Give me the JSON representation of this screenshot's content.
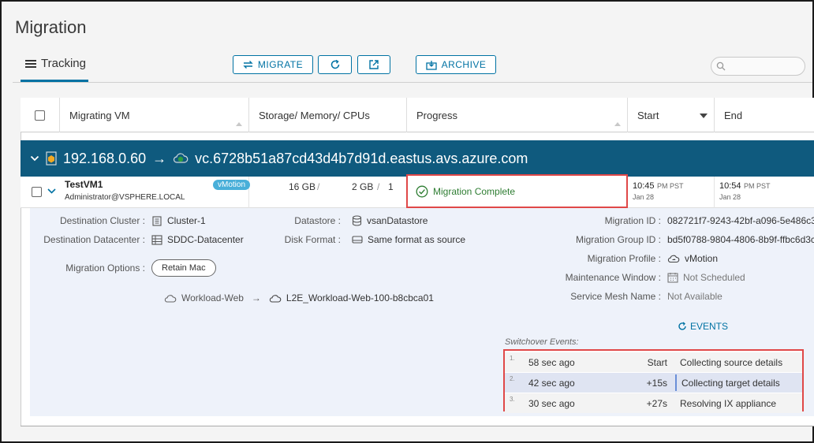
{
  "page": {
    "title": "Migration"
  },
  "tabs": [
    {
      "label": "Tracking",
      "active": true
    }
  ],
  "toolbar": {
    "migrate_label": "MIGRATE",
    "archive_label": "ARCHIVE",
    "refresh_icon": "refresh-icon",
    "export_icon": "export-icon"
  },
  "search": {
    "placeholder": ""
  },
  "columns": [
    {
      "label": "Migrating VM"
    },
    {
      "label": "Storage/ Memory/ CPUs"
    },
    {
      "label": "Progress"
    },
    {
      "label": "Start"
    },
    {
      "label": "End"
    }
  ],
  "group": {
    "source": "192.168.0.60",
    "arrow": "→",
    "destination": "vc.6728b51a87cd43d4b7d91d.eastus.avs.azure.com"
  },
  "vm": {
    "name": "TestVM1",
    "owner": "Administrator@VSPHERE.LOCAL",
    "badge": "vMotion",
    "storage": "16 GB",
    "sep1": "/",
    "memory": "2 GB",
    "sep2": "/",
    "cpus": "1",
    "progress": "Migration Complete",
    "start_time": "10:45",
    "start_tz": "PM PST",
    "start_date": "Jan 28",
    "end_time": "10:54",
    "end_tz": "PM PST",
    "end_date": "Jan 28"
  },
  "details": {
    "dest_cluster_label": "Destination Cluster :",
    "dest_cluster": "Cluster-1",
    "dest_dc_label": "Destination Datacenter :",
    "dest_dc": "SDDC-Datacenter",
    "datastore_label": "Datastore :",
    "datastore": "vsanDatastore",
    "disk_format_label": "Disk Format :",
    "disk_format": "Same format as source",
    "migration_options_label": "Migration Options :",
    "retain_mac": "Retain Mac",
    "network_source": "Workload-Web",
    "network_arrow": "→",
    "network_dest": "L2E_Workload-Web-100-b8cbca01",
    "migration_id_label": "Migration ID :",
    "migration_id": "082721f7-9243-42bf-a096-5e486c3",
    "migration_group_label": "Migration Group ID :",
    "migration_group_id": "bd5f0788-9804-4806-8b9f-ffbc6d3c",
    "profile_label": "Migration Profile :",
    "profile": "vMotion",
    "maintenance_label": "Maintenance Window :",
    "maintenance": "Not Scheduled",
    "mesh_label": "Service Mesh Name :",
    "mesh": "Not Available",
    "events_link": "EVENTS"
  },
  "switchover": {
    "title": "Switchover Events:",
    "events": [
      {
        "num": "1.",
        "ago": "58 sec ago",
        "offset": "Start",
        "desc": "Collecting source details"
      },
      {
        "num": "2.",
        "ago": "42 sec ago",
        "offset": "+15s",
        "desc": "Collecting target details"
      },
      {
        "num": "3.",
        "ago": "30 sec ago",
        "offset": "+27s",
        "desc": "Resolving IX appliance"
      }
    ]
  },
  "colors": {
    "accent": "#0072a3",
    "group_bg": "#0f5a7e",
    "success": "#2e7d32",
    "highlight": "#e04848"
  }
}
